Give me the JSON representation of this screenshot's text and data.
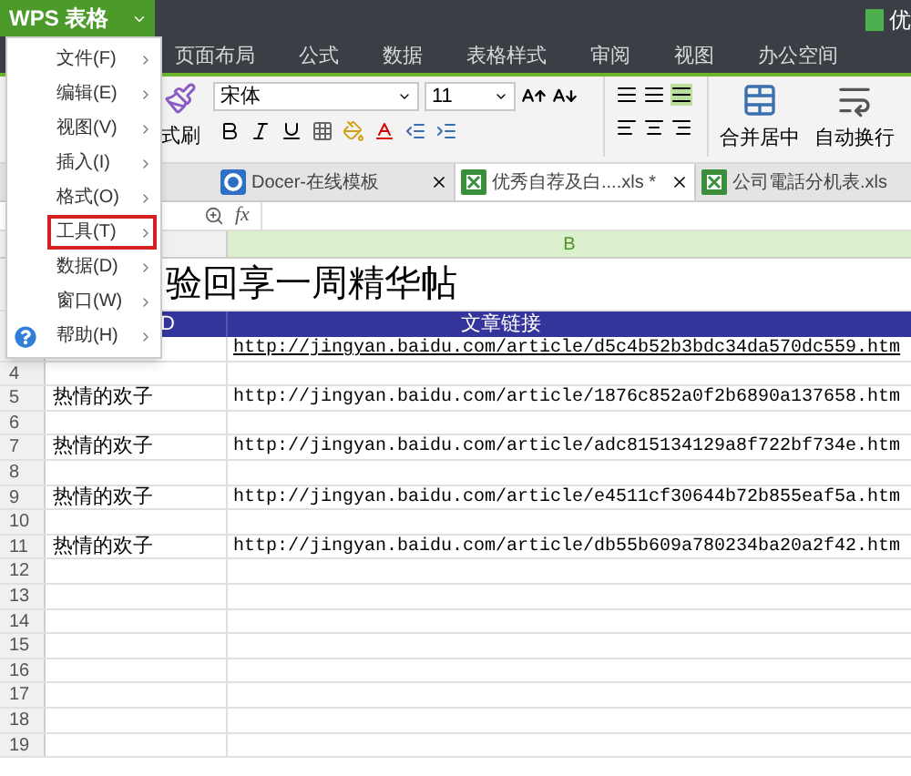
{
  "app_button": {
    "label": "WPS 表格"
  },
  "title_bar": {
    "document": "优"
  },
  "menu_tabs": [
    {
      "label": "页面布局"
    },
    {
      "label": "公式"
    },
    {
      "label": "数据"
    },
    {
      "label": "表格样式"
    },
    {
      "label": "审阅"
    },
    {
      "label": "视图"
    },
    {
      "label": "办公空间"
    }
  ],
  "ribbon": {
    "format_painter": "式刷",
    "font": "宋体",
    "font_size": "11",
    "merge_center": "合并居中",
    "wrap_text": "自动换行"
  },
  "doc_tabs": [
    {
      "label": "Docer-在线模板",
      "kind": "docer",
      "selected": false
    },
    {
      "label": "优秀自荐及白....xls *",
      "kind": "sheet",
      "selected": true
    },
    {
      "label": "公司電話分机表.xls",
      "kind": "sheet",
      "selected": false
    }
  ],
  "formula_bar": {
    "function_label": "fx"
  },
  "app_menu": {
    "items": [
      {
        "label": "文件(F)",
        "kind": "plain",
        "selected": false
      },
      {
        "label": "编辑(E)",
        "kind": "plain",
        "selected": false
      },
      {
        "label": "视图(V)",
        "kind": "plain",
        "selected": false
      },
      {
        "label": "插入(I)",
        "kind": "plain",
        "selected": false
      },
      {
        "label": "格式(O)",
        "kind": "plain",
        "selected": false
      },
      {
        "label": "工具(T)",
        "kind": "plain",
        "selected": true
      },
      {
        "label": "数据(D)",
        "kind": "plain",
        "selected": false
      },
      {
        "label": "窗口(W)",
        "kind": "plain",
        "selected": false
      },
      {
        "label": "帮助(H)",
        "kind": "help",
        "selected": false
      }
    ]
  },
  "sheet": {
    "column_header": "B",
    "title": "验回享一周精华帖",
    "header": {
      "column_a": "D",
      "column_b": "文章链接"
    },
    "rows": [
      {
        "number": "",
        "a": "",
        "b": "http://jingyan.baidu.com/article/d5c4b52b3bdc34da570dc559.htm",
        "link": true
      },
      {
        "number": "4",
        "a": "",
        "b": ""
      },
      {
        "number": "5",
        "a": "热情的欢子",
        "b": "http://jingyan.baidu.com/article/1876c852a0f2b6890a137658.htm"
      },
      {
        "number": "6",
        "a": "",
        "b": ""
      },
      {
        "number": "7",
        "a": "热情的欢子",
        "b": "http://jingyan.baidu.com/article/adc815134129a8f722bf734e.htm"
      },
      {
        "number": "8",
        "a": "",
        "b": ""
      },
      {
        "number": "9",
        "a": "热情的欢子",
        "b": "http://jingyan.baidu.com/article/e4511cf30644b72b855eaf5a.htm"
      },
      {
        "number": "10",
        "a": "",
        "b": ""
      },
      {
        "number": "11",
        "a": "热情的欢子",
        "b": "http://jingyan.baidu.com/article/db55b609a780234ba20a2f42.htm"
      },
      {
        "number": "12",
        "a": "",
        "b": ""
      },
      {
        "number": "13",
        "a": "",
        "b": ""
      },
      {
        "number": "14",
        "a": "",
        "b": ""
      },
      {
        "number": "15",
        "a": "",
        "b": ""
      },
      {
        "number": "16",
        "a": "",
        "b": ""
      },
      {
        "number": "17",
        "a": "",
        "b": ""
      },
      {
        "number": "18",
        "a": "",
        "b": ""
      },
      {
        "number": "19",
        "a": "",
        "b": ""
      }
    ]
  }
}
